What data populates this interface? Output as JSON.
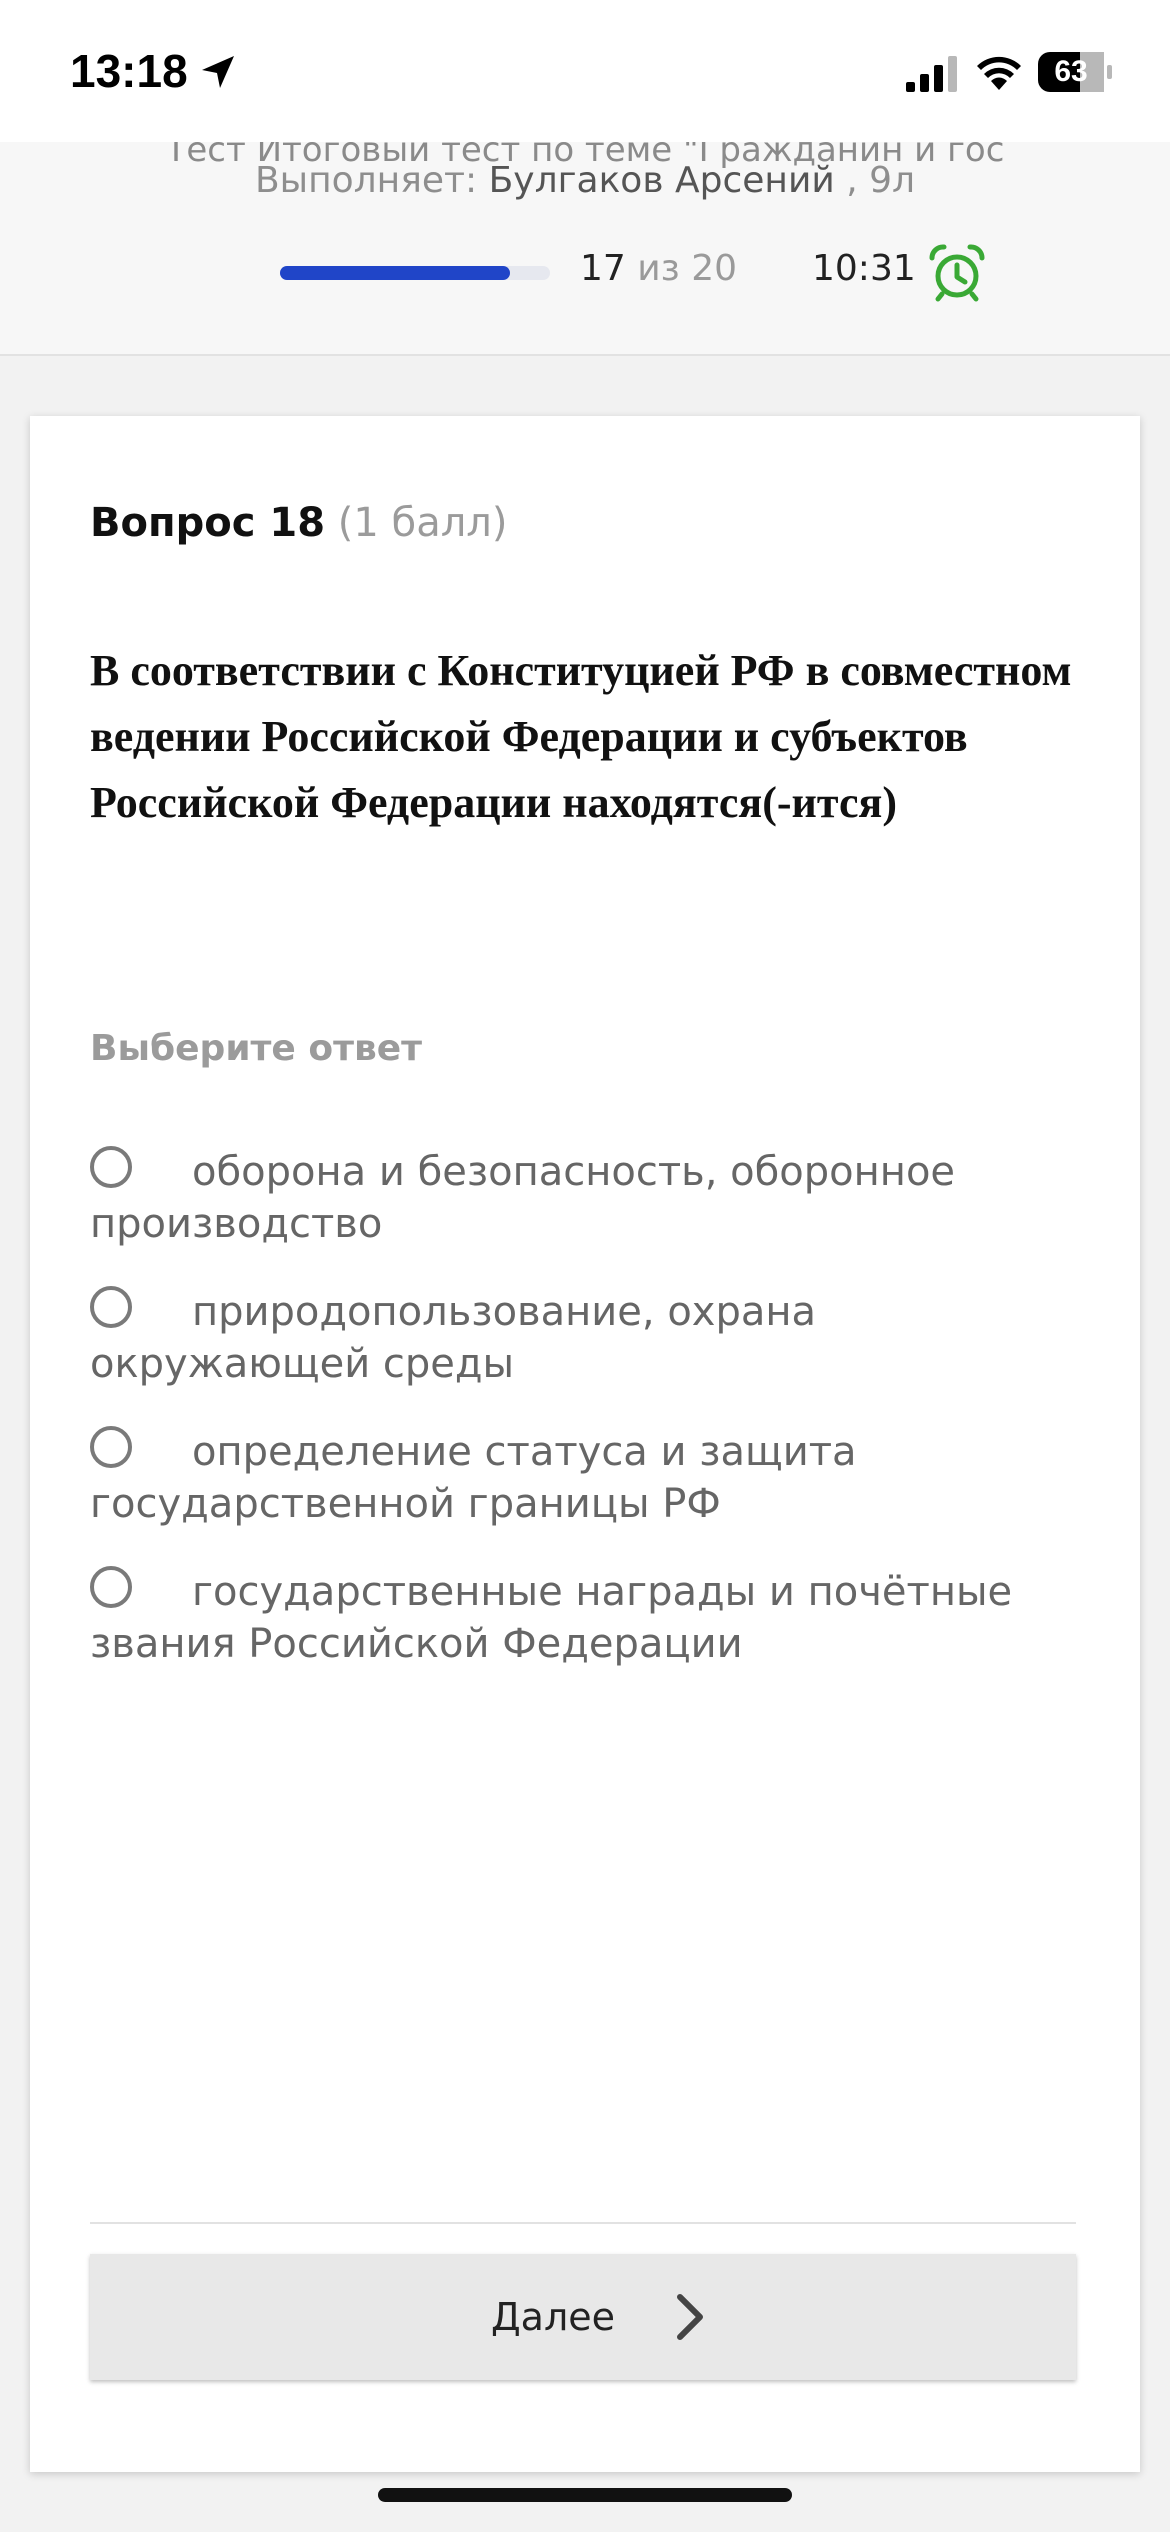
{
  "status_bar": {
    "time": "13:18",
    "battery": "63"
  },
  "header": {
    "test_title": "Тест Итоговый тест по теме \"Гражданин и гос",
    "performer_label": "Выполняет:",
    "performer_name": "Булгаков Арсений",
    "performer_class": ", 9л",
    "progress_current": "17",
    "progress_separator": "из",
    "progress_total": "20",
    "progress_fraction": 0.85,
    "timer": "10:31"
  },
  "question": {
    "label": "Вопрос 18",
    "points": "(1 балл)",
    "text": "В соответствии с Конституцией РФ в совместном ведении Российской Федерации и субъектов Российской Федерации находятся(-ится)",
    "choose_label": "Выберите ответ",
    "options": [
      {
        "text": "оборона и безопасность, оборонное производство"
      },
      {
        "text": "природопользование, охрана окружающей среды"
      },
      {
        "text": "определение статуса и защита государственной границы РФ"
      },
      {
        "text": "государственные награды и почётные звания Российской Федерации"
      }
    ]
  },
  "footer": {
    "next_label": "Далее"
  },
  "colors": {
    "progress": "#2045c8",
    "alarm": "#3aa935"
  }
}
